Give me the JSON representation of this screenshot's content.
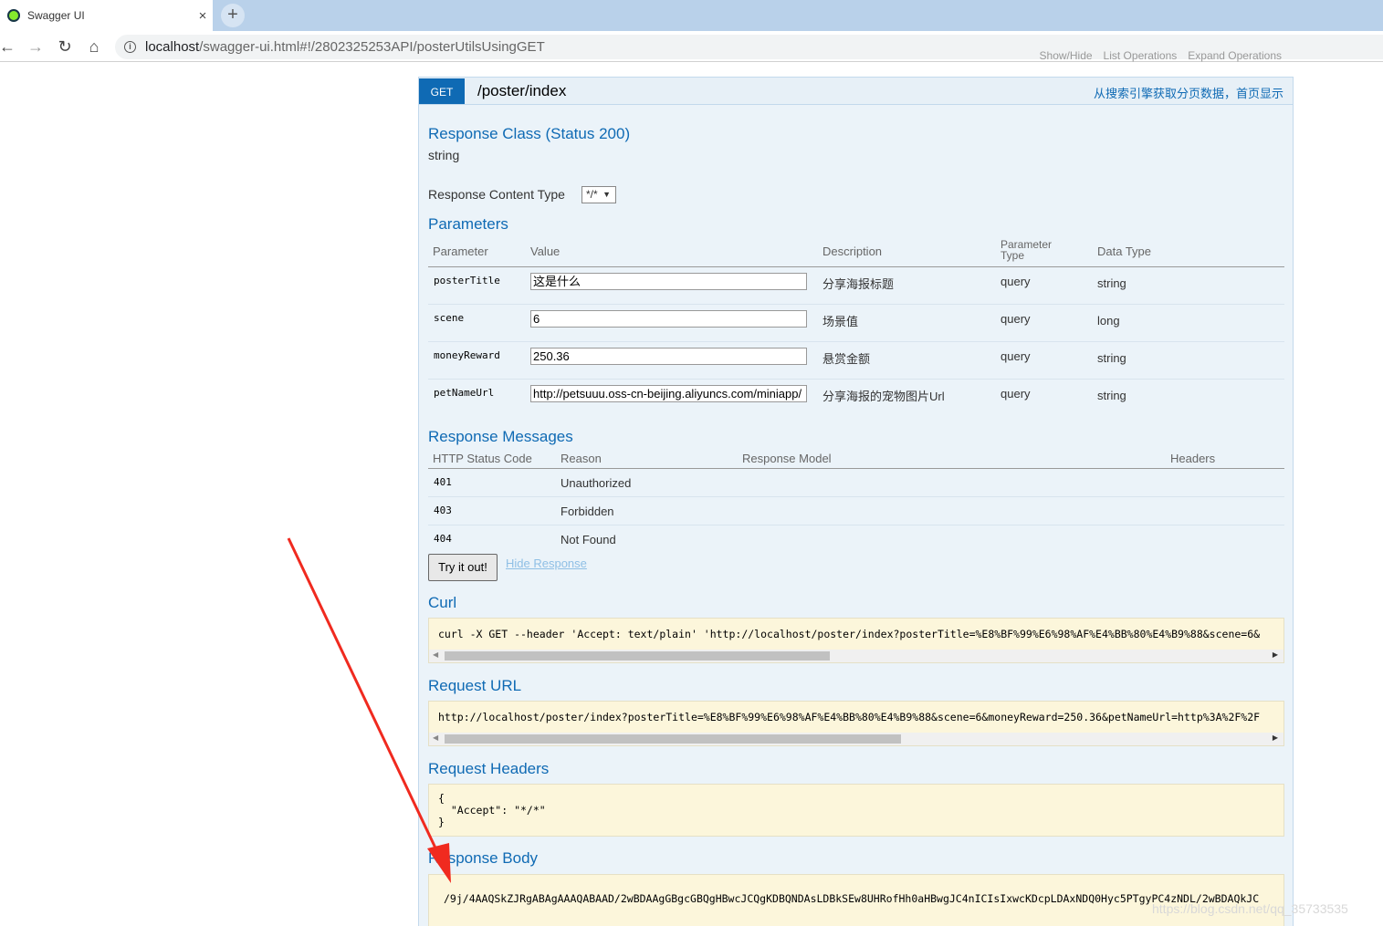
{
  "browser": {
    "tab_title": "Swagger UI",
    "tab_close": "×",
    "new_tab": "+",
    "back": "←",
    "forward": "→",
    "reload": "↻",
    "home": "⌂",
    "info": "i",
    "url_host": "localhost",
    "url_path": "/swagger-ui.html#!/2802325253API/posterUtilsUsingGET"
  },
  "partial_header": {
    "links": [
      "Show/Hide",
      "List Operations",
      "Expand Operations"
    ]
  },
  "operation": {
    "method": "GET",
    "path": "/poster/index",
    "summary": "从搜索引擎获取分页数据，首页显示"
  },
  "response_class": {
    "heading": "Response Class (Status 200)",
    "type": "string"
  },
  "content_type": {
    "label": "Response Content Type",
    "value": "*/*",
    "arrow": "▼"
  },
  "parameters": {
    "heading": "Parameters",
    "headers": {
      "parameter": "Parameter",
      "value": "Value",
      "description": "Description",
      "param_type_1": "Parameter",
      "param_type_2": "Type",
      "data_type": "Data Type"
    },
    "rows": [
      {
        "name": "posterTitle",
        "value": "这是什么",
        "description": "分享海报标题",
        "type": "query",
        "data_type": "string"
      },
      {
        "name": "scene",
        "value": "6",
        "description": "场景值",
        "type": "query",
        "data_type": "long"
      },
      {
        "name": "moneyReward",
        "value": "250.36",
        "description": "悬赏金额",
        "type": "query",
        "data_type": "string"
      },
      {
        "name": "petNameUrl",
        "value": "http://petsuuu.oss-cn-beijing.aliyuncs.com/miniapp/",
        "description": "分享海报的宠物图片Url",
        "type": "query",
        "data_type": "string"
      }
    ]
  },
  "response_messages": {
    "heading": "Response Messages",
    "headers": {
      "code": "HTTP Status Code",
      "reason": "Reason",
      "model": "Response Model",
      "headers": "Headers"
    },
    "rows": [
      {
        "code": "401",
        "reason": "Unauthorized"
      },
      {
        "code": "403",
        "reason": "Forbidden"
      },
      {
        "code": "404",
        "reason": "Not Found"
      }
    ]
  },
  "actions": {
    "try_it": "Try it out!",
    "hide_response": "Hide Response"
  },
  "curl": {
    "heading": "Curl",
    "command": "curl -X GET --header 'Accept: text/plain' 'http://localhost/poster/index?posterTitle=%E8%BF%99%E6%98%AF%E4%BB%80%E4%B9%88&scene=6&"
  },
  "request_url": {
    "heading": "Request URL",
    "url": "http://localhost/poster/index?posterTitle=%E8%BF%99%E6%98%AF%E4%BB%80%E4%B9%88&scene=6&moneyReward=250.36&petNameUrl=http%3A%2F%2F"
  },
  "request_headers": {
    "heading": "Request Headers",
    "line1": "{",
    "line2": "  \"Accept\": \"*/*\"",
    "line3": "}"
  },
  "response_body": {
    "heading": "Response Body",
    "body": "/9j/4AAQSkZJRgABAgAAAQABAAD/2wBDAAgGBgcGBQgHBwcJCQgKDBQNDAsLDBkSEw8UHRofHh0aHBwgJC4nICIsIxwcKDcpLDAxNDQ0Hyc5PTgyPC4zNDL/2wBDAQkJC"
  },
  "watermark": "https://blog.csdn.net/qq_35733535",
  "colors": {
    "accent": "#0f6ab4",
    "op_background": "#ebf3f9",
    "code_background": "#fcf6db",
    "annotation_arrow": "#f02a1f"
  }
}
